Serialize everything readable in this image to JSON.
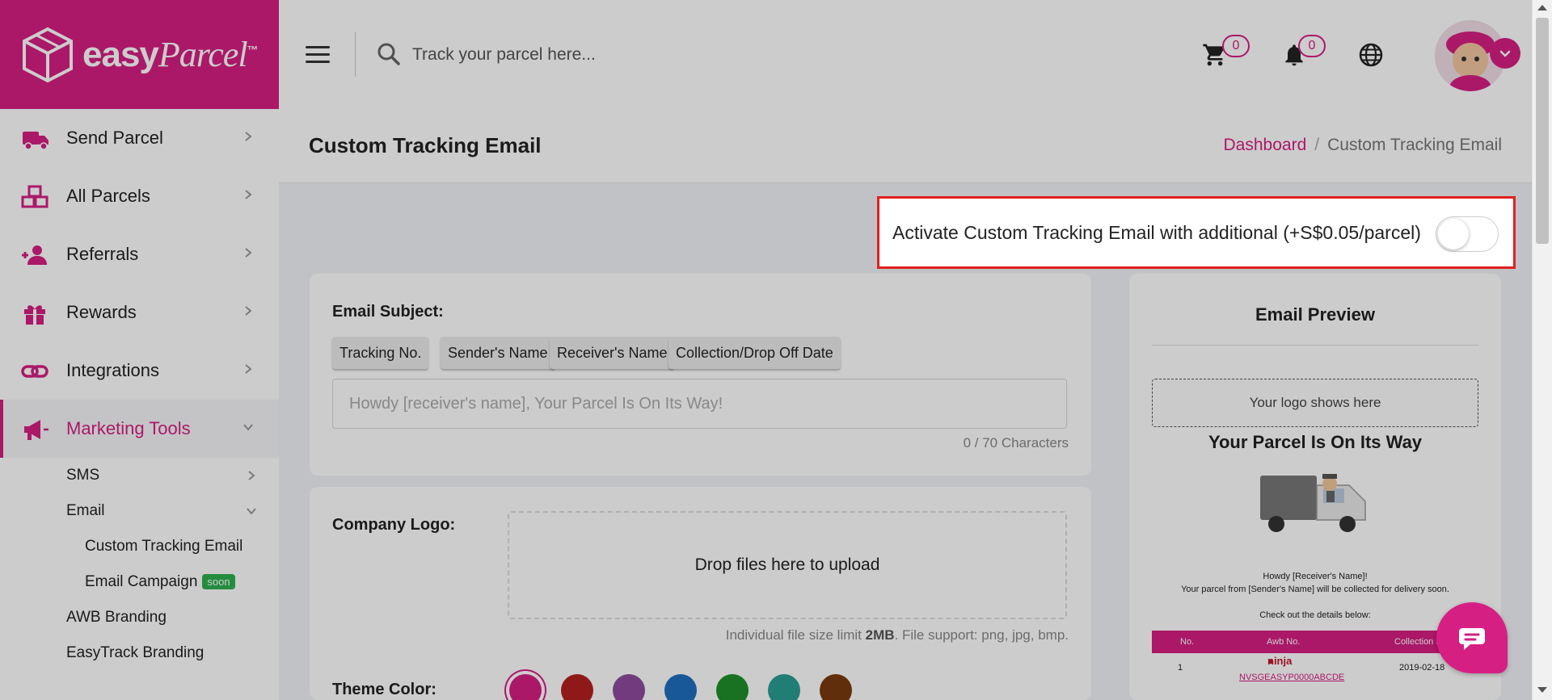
{
  "brand": {
    "name_plain": "easy",
    "name_script": "Parcel",
    "tm": "™",
    "color": "#d61f83"
  },
  "header": {
    "search_placeholder": "Track your parcel here...",
    "cart_count": "0",
    "notification_count": "0"
  },
  "sidebar": {
    "items": [
      {
        "label": "Send Parcel",
        "icon": "truck-icon"
      },
      {
        "label": "All Parcels",
        "icon": "boxes-icon"
      },
      {
        "label": "Referrals",
        "icon": "user-plus-icon"
      },
      {
        "label": "Rewards",
        "icon": "gift-icon"
      },
      {
        "label": "Integrations",
        "icon": "link-icon"
      },
      {
        "label": "Marketing Tools",
        "icon": "megaphone-icon"
      }
    ],
    "sub": {
      "sms": "SMS",
      "email": "Email",
      "custom_tracking_email": "Custom Tracking Email",
      "email_campaign": "Email Campaign",
      "soon_badge": "soon",
      "awb_branding": "AWB Branding",
      "easytrack_branding": "EasyTrack Branding"
    }
  },
  "page": {
    "title": "Custom Tracking Email",
    "breadcrumb": {
      "home": "Dashboard",
      "separator": "/",
      "current": "Custom Tracking Email"
    }
  },
  "activation": {
    "label": "Activate Custom Tracking Email with additional (+S$0.05/parcel)",
    "enabled": false
  },
  "subject": {
    "label": "Email Subject:",
    "chips": [
      "Tracking No.",
      "Sender's Name",
      "Receiver's Name",
      "Collection/Drop Off Date"
    ],
    "placeholder": "Howdy [receiver's name], Your Parcel Is On Its Way!",
    "char_count": "0 / 70 Characters"
  },
  "company_logo": {
    "label": "Company Logo:",
    "drop_text": "Drop files here to upload",
    "hint_prefix": "Individual file size limit",
    "hint_size": "2MB",
    "hint_suffix": ". File support: png, jpg, bmp."
  },
  "theme": {
    "label": "Theme Color:",
    "colors": [
      "#d61f83",
      "#b3201f",
      "#8e4a9e",
      "#1f6fbf",
      "#1f8f2a",
      "#2a9e93",
      "#7a3a0f"
    ],
    "selected": "#d61f83"
  },
  "preview": {
    "title": "Email Preview",
    "logo_placeholder": "Your logo shows here",
    "heading": "Your Parcel Is On Its Way",
    "greeting": "Howdy [Receiver's Name]!",
    "message": "Your parcel from [Sender's Name] will be collected for delivery soon.",
    "details_intro": "Check out the details below:",
    "table": {
      "headers": [
        "No.",
        "Awb No.",
        "Collection D"
      ],
      "row": {
        "no": "1",
        "courier": "ninja",
        "awb": "NVSGEASYP0000ABCDE",
        "date": "2019-02-18"
      }
    }
  }
}
